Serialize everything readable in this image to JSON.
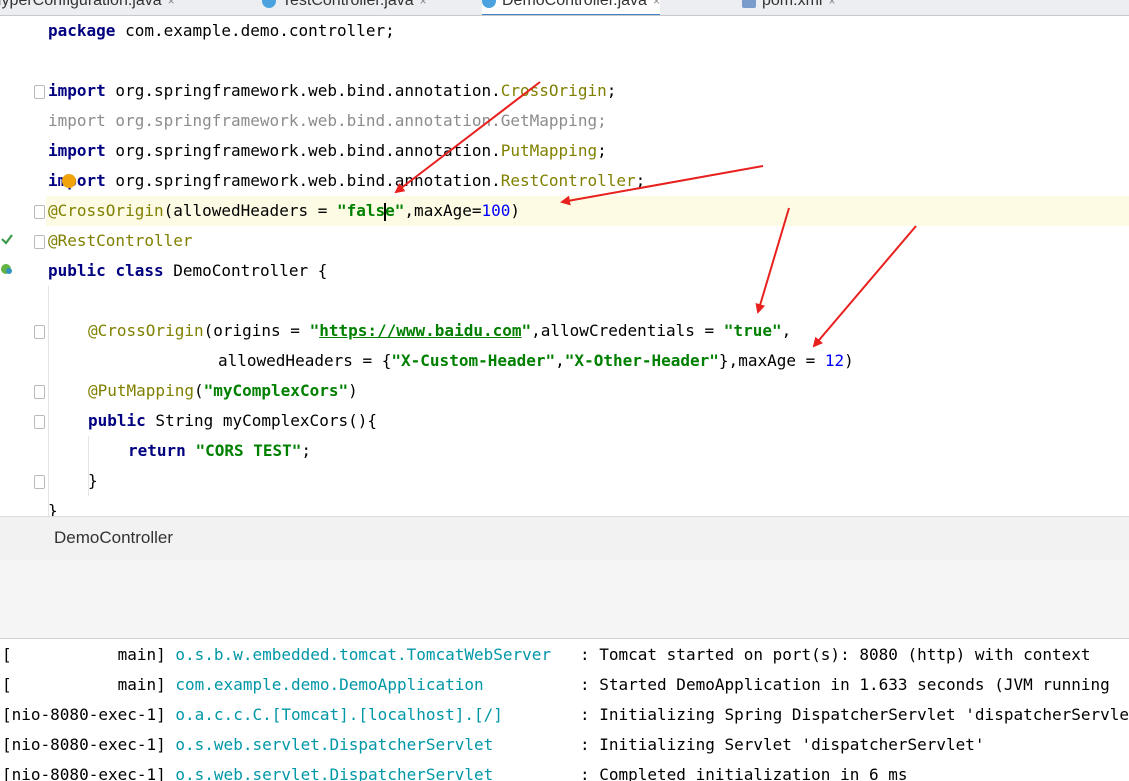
{
  "tabs": [
    {
      "label": "HyperConfiguration.java",
      "close": "×"
    },
    {
      "label": "TestController.java",
      "close": "×"
    },
    {
      "label": "DemoController.java",
      "close": "×"
    },
    {
      "label": "pom.xml",
      "close": "×"
    }
  ],
  "editor": {
    "l1": {
      "kw": "package",
      "rest": " com.example.demo.controller;"
    },
    "l3": {
      "kw": "import",
      "pkg": " org.springframework.web.bind.annotation.",
      "cls": "CrossOrigin",
      "end": ";"
    },
    "l4": {
      "kw": "import",
      "pkg": " org.springframework.web.bind.annotation.",
      "cls": "GetMapping",
      "end": ";"
    },
    "l5": {
      "kw": "import",
      "pkg": " org.springframework.web.bind.annotation.",
      "cls": "PutMapping",
      "end": ";"
    },
    "l6": {
      "kw": "import",
      "pkg": " org.springframework.web.bind.annotation.",
      "cls": "RestController",
      "end": ";"
    },
    "l7": {
      "ann": "@CrossOrigin",
      "a": "(allowedHeaders = ",
      "s1": "\"fals",
      "s2": "e\"",
      "b": ",maxAge=",
      "num": "100",
      "c": ")"
    },
    "l8": {
      "ann": "@RestController"
    },
    "l9": {
      "kw1": "public",
      "kw2": "class",
      "rest": " DemoController {"
    },
    "l11": {
      "ann": "@CrossOrigin",
      "a": "(origins = ",
      "q1": "\"",
      "url": "https://www.baidu.com",
      "q2": "\"",
      "b": ",allowCredentials = ",
      "s": "\"true\"",
      "c": ","
    },
    "l12": {
      "a": "allowedHeaders = {",
      "s1": "\"X-Custom-Header\"",
      "comma": ",",
      "s2": "\"X-Other-Header\"",
      "b": "},maxAge = ",
      "num": "12",
      "c": ")"
    },
    "l13": {
      "ann": "@PutMapping",
      "a": "(",
      "s": "\"myComplexCors\"",
      "c": ")"
    },
    "l14": {
      "kw": "public",
      "rest": " String myComplexCors(){"
    },
    "l15": {
      "kw": "return",
      "s": "\"CORS TEST\"",
      "c": ";"
    },
    "l16": {
      "rest": "}"
    },
    "l17": {
      "rest": "}"
    }
  },
  "breadcrumb": "DemoController",
  "console": [
    {
      "thread": "[           main] ",
      "logger": "o.s.b.w.embedded.tomcat.TomcatWebServer  ",
      "msg": " : Tomcat started on port(s): 8080 (http) with context"
    },
    {
      "thread": "[           main] ",
      "logger": "com.example.demo.DemoApplication         ",
      "msg": " : Started DemoApplication in 1.633 seconds (JVM running"
    },
    {
      "thread": "[nio-8080-exec-1] ",
      "logger": "o.a.c.c.C.[Tomcat].[localhost].[/]       ",
      "msg": " : Initializing Spring DispatcherServlet 'dispatcherServlet'"
    },
    {
      "thread": "[nio-8080-exec-1] ",
      "logger": "o.s.web.servlet.DispatcherServlet        ",
      "msg": " : Initializing Servlet 'dispatcherServlet'"
    },
    {
      "thread": "[nio-8080-exec-1] ",
      "logger": "o.s.web.servlet.DispatcherServlet        ",
      "msg": " : Completed initialization in 6 ms"
    }
  ],
  "colors": {
    "arrow": "#e8201e",
    "keyword": "#000080",
    "annotation": "#808000",
    "string": "#008000",
    "logger": "#0097a7"
  }
}
